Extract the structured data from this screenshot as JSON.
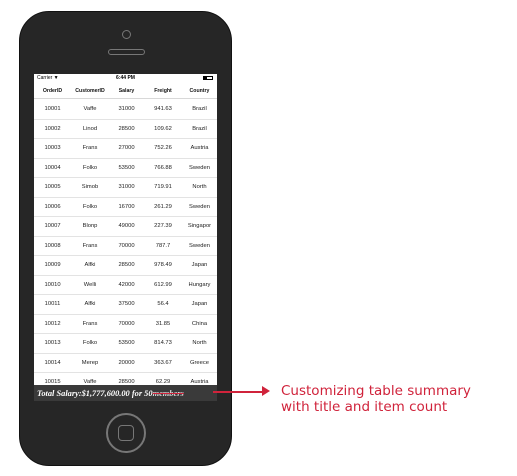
{
  "status_bar": {
    "carrier": "Carrier",
    "wifi_icon": "wifi-icon",
    "time": "6:44 PM",
    "battery_icon": "battery-icon"
  },
  "columns": [
    "OrderID",
    "CustomerID",
    "Salary",
    "Freight",
    "Country"
  ],
  "rows": [
    [
      "10001",
      "Vaffe",
      "31000",
      "941.63",
      "Brazil"
    ],
    [
      "10002",
      "Linod",
      "28500",
      "109.62",
      "Brazil"
    ],
    [
      "10003",
      "Frans",
      "27000",
      "752.26",
      "Austria"
    ],
    [
      "10004",
      "Folko",
      "53500",
      "766.88",
      "Sweden"
    ],
    [
      "10005",
      "Simob",
      "31000",
      "719.91",
      "North"
    ],
    [
      "10006",
      "Folko",
      "16700",
      "261.29",
      "Sweden"
    ],
    [
      "10007",
      "Blonp",
      "49000",
      "227.39",
      "Singapor"
    ],
    [
      "10008",
      "Frans",
      "70000",
      "787.7",
      "Sweden"
    ],
    [
      "10009",
      "Alfki",
      "28500",
      "978.49",
      "Japan"
    ],
    [
      "10010",
      "Welli",
      "42000",
      "612.99",
      "Hungary"
    ],
    [
      "10011",
      "Alfki",
      "37500",
      "56.4",
      "Japan"
    ],
    [
      "10012",
      "Frans",
      "70000",
      "31.85",
      "China"
    ],
    [
      "10013",
      "Folko",
      "53500",
      "814.73",
      "North"
    ],
    [
      "10014",
      "Merep",
      "20000",
      "363.67",
      "Greece"
    ],
    [
      "10015",
      "Vaffe",
      "28500",
      "62.29",
      "Austria"
    ]
  ],
  "summary": {
    "main": "Total Salary:$1,777,600.00 for 50 ",
    "struck": "members"
  },
  "callout": {
    "line1": "Customizing table summary",
    "line2": "with title and item count"
  },
  "colors": {
    "accent": "#d0233b",
    "phone_body": "#262626",
    "summary_bg": "#3a3a3a"
  }
}
